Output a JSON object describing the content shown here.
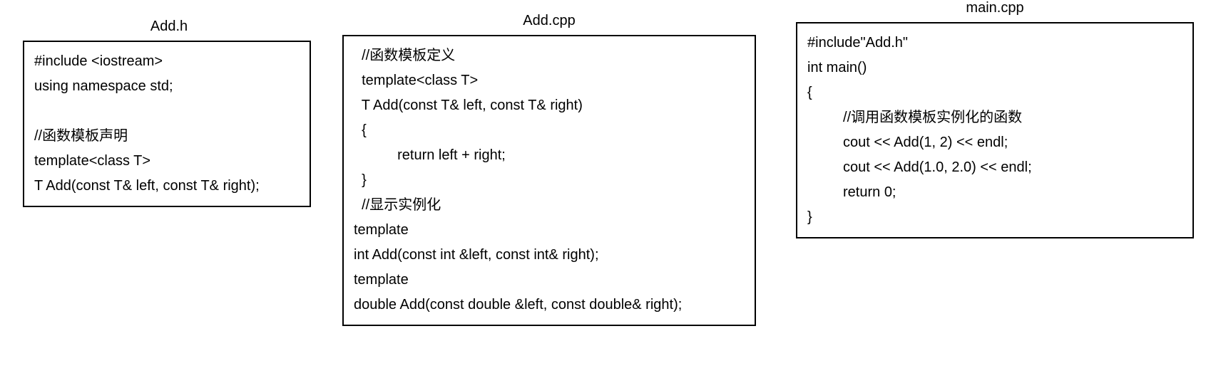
{
  "files": {
    "add_h": {
      "title": "Add.h",
      "code": "#include <iostream>\nusing namespace std;\n\n//函数模板声明\ntemplate<class T>\nT Add(const T& left, const T& right);"
    },
    "add_cpp": {
      "title": "Add.cpp",
      "code": "  //函数模板定义\n  template<class T>\n  T Add(const T& left, const T& right)\n  {\n           return left + right;\n  }\n  //显示实例化\ntemplate\nint Add(const int &left, const int& right);\ntemplate\ndouble Add(const double &left, const double& right);"
    },
    "main_cpp": {
      "title": "main.cpp",
      "code": "#include\"Add.h\"\nint main()\n{\n         //调用函数模板实例化的函数\n         cout << Add(1, 2) << endl;\n         cout << Add(1.0, 2.0) << endl;\n         return 0;\n}"
    }
  }
}
